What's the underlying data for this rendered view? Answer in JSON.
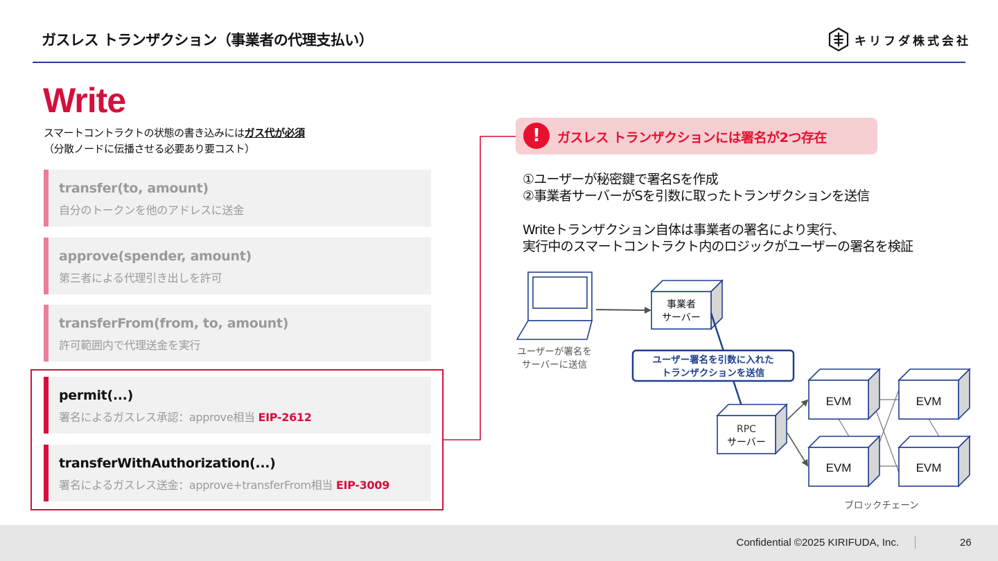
{
  "header": {
    "title": "ガスレス トランザクション（事業者の代理支払い）",
    "company": "キリフダ株式会社"
  },
  "section": {
    "heading": "Write",
    "subtitle_prefix": "スマートコントラクトの状態の書き込みには",
    "subtitle_emphasis": "ガス代が必須",
    "subtitle_note": "（分散ノードに伝播させる必要あり要コスト）"
  },
  "functions": [
    {
      "name": "transfer(to, amount)",
      "desc": "自分のトークンを他のアドレスに送金",
      "eip": ""
    },
    {
      "name": "approve(spender, amount)",
      "desc": "第三者による代理引き出しを許可",
      "eip": ""
    },
    {
      "name": "transferFrom(from, to, amount)",
      "desc": "許可範囲内で代理送金を実行",
      "eip": ""
    },
    {
      "name": "permit(...)",
      "desc": "署名によるガスレス承認：approve相当",
      "eip": "EIP-2612"
    },
    {
      "name": "transferWithAuthorization(...)",
      "desc": "署名によるガスレス送金：approve+transferFrom相当",
      "eip": "EIP-3009"
    }
  ],
  "callout": {
    "icon": "exclamation-icon",
    "text": "ガスレス トランザクションには署名が2つ存在",
    "points": [
      "①ユーザーが秘密鍵で署名Sを作成",
      "②事業者サーバーがSを引数に取ったトランザクションを送信"
    ],
    "explanation": [
      "Writeトランザクション自体は事業者の署名により実行、",
      "実行中のスマートコントラクト内のロジックがユーザーの署名を検証"
    ]
  },
  "diagram": {
    "user_caption": [
      "ユーザーが署名を",
      "サーバーに送信"
    ],
    "business_server": [
      "事業者",
      "サーバー"
    ],
    "tx_label": [
      "ユーザー署名を引数に入れた",
      "トランザクションを送信"
    ],
    "rpc_server": [
      "RPC",
      "サーバー"
    ],
    "evm_label": "EVM",
    "blockchain_caption": "ブロックチェーン"
  },
  "colors": {
    "accent": "#d50f3c",
    "rule": "#1f3f8f",
    "tx_label_border": "#1f3f8f",
    "node_border": "#1f3f8f",
    "banner_bg": "#f6cfd2"
  },
  "footer": {
    "confidential": "Confidential ©2025 KIRIFUDA, Inc.",
    "page": "26"
  }
}
